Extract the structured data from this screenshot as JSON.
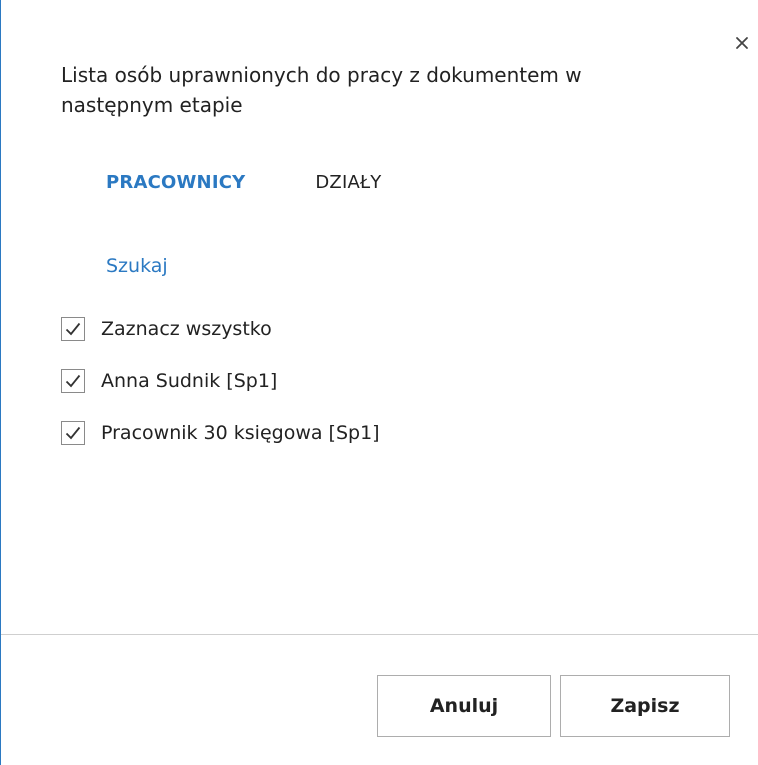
{
  "dialog": {
    "title": "Lista osób uprawnionych do pracy z dokumentem w następnym etapie",
    "close_icon": "close-icon"
  },
  "tabs": [
    {
      "label": "PRACOWNICY",
      "active": true
    },
    {
      "label": "DZIAŁY",
      "active": false
    }
  ],
  "search": {
    "label": "Szukaj"
  },
  "checklist": [
    {
      "label": "Zaznacz wszystko",
      "checked": true
    },
    {
      "label": "Anna Sudnik [Sp1]",
      "checked": true
    },
    {
      "label": "Pracownik 30 księgowa [Sp1]",
      "checked": true
    }
  ],
  "footer": {
    "cancel_label": "Anuluj",
    "save_label": "Zapisz"
  },
  "colors": {
    "accent": "#2b79c2",
    "text": "#222222",
    "border": "#adadad"
  }
}
